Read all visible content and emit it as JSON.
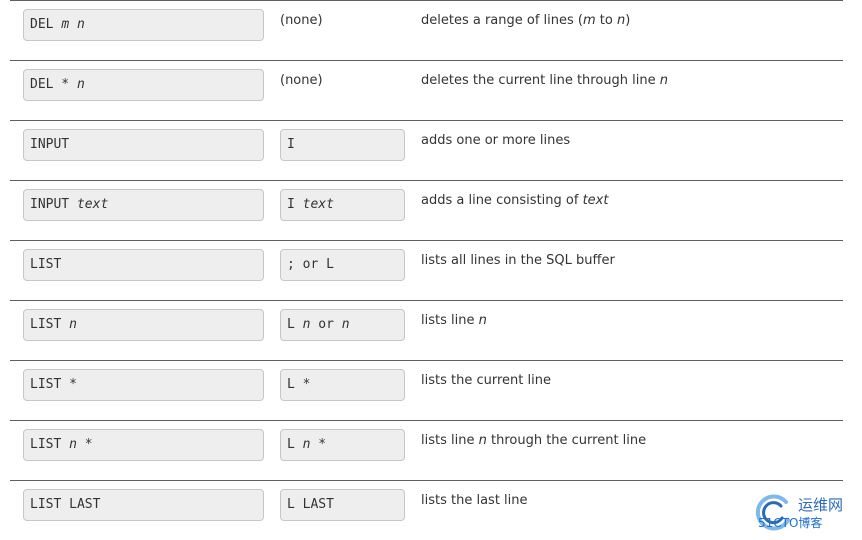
{
  "rows": [
    {
      "cmd": [
        [
          "DEL ",
          false
        ],
        [
          "m",
          true
        ],
        [
          " ",
          false
        ],
        [
          "n",
          true
        ]
      ],
      "abbr_plain": "(none)",
      "desc": [
        [
          "deletes a range of lines (",
          false
        ],
        [
          "m",
          true
        ],
        [
          " to ",
          false
        ],
        [
          "n",
          true
        ],
        [
          ")",
          false
        ]
      ]
    },
    {
      "cmd": [
        [
          "DEL * ",
          false
        ],
        [
          "n",
          true
        ]
      ],
      "abbr_plain": "(none)",
      "desc": [
        [
          "deletes the current line through line ",
          false
        ],
        [
          "n",
          true
        ]
      ]
    },
    {
      "cmd": [
        [
          "INPUT",
          false
        ]
      ],
      "abbr": [
        [
          "I",
          false
        ]
      ],
      "desc": [
        [
          "adds one or more lines",
          false
        ]
      ]
    },
    {
      "cmd": [
        [
          "INPUT ",
          false
        ],
        [
          "text",
          true
        ]
      ],
      "abbr": [
        [
          "I ",
          false
        ],
        [
          "text",
          true
        ]
      ],
      "desc": [
        [
          "adds a line consisting of ",
          false
        ],
        [
          "text",
          true
        ]
      ]
    },
    {
      "cmd": [
        [
          "LIST",
          false
        ]
      ],
      "abbr": [
        [
          "; or L",
          false
        ]
      ],
      "desc": [
        [
          "lists all lines in the SQL buffer",
          false
        ]
      ]
    },
    {
      "cmd": [
        [
          "LIST ",
          false
        ],
        [
          "n",
          true
        ]
      ],
      "abbr": [
        [
          "L ",
          false
        ],
        [
          "n",
          true
        ],
        [
          " or ",
          false
        ],
        [
          "n",
          true
        ]
      ],
      "desc": [
        [
          "lists line ",
          false
        ],
        [
          "n",
          true
        ]
      ]
    },
    {
      "cmd": [
        [
          "LIST *",
          false
        ]
      ],
      "abbr": [
        [
          "L *",
          false
        ]
      ],
      "desc": [
        [
          "lists the current line",
          false
        ]
      ]
    },
    {
      "cmd": [
        [
          "LIST ",
          false
        ],
        [
          "n",
          true
        ],
        [
          " *",
          false
        ]
      ],
      "abbr": [
        [
          "L ",
          false
        ],
        [
          "n",
          true
        ],
        [
          " *",
          false
        ]
      ],
      "desc": [
        [
          "lists line ",
          false
        ],
        [
          "n",
          true
        ],
        [
          " through the current line",
          false
        ]
      ]
    },
    {
      "cmd": [
        [
          "LIST LAST",
          false
        ]
      ],
      "abbr": [
        [
          "L LAST",
          false
        ]
      ],
      "desc": [
        [
          "lists the last line",
          false
        ]
      ]
    }
  ],
  "watermark": {
    "title": "运维网",
    "subtitle": "51CTO博客",
    "colors": {
      "blue": "#2a6ab8",
      "light_blue": "#7fb8ea"
    }
  }
}
